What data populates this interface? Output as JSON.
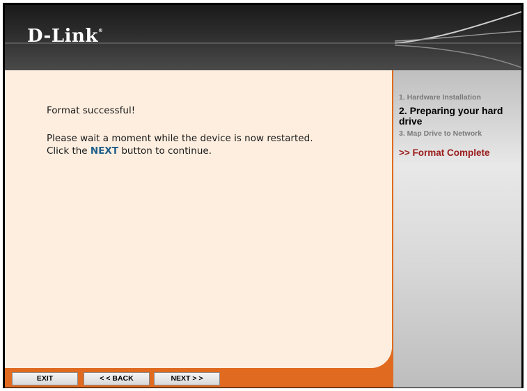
{
  "header": {
    "logo_text": "D-Link",
    "logo_mark": "®"
  },
  "main": {
    "message_success": "Format successful!",
    "message_line1": "Please wait a moment while the device is now restarted.",
    "message_line2_prefix": "Click the ",
    "message_line2_emphasis": "NEXT",
    "message_line2_suffix": " button to continue."
  },
  "sidebar": {
    "step1": "1. Hardware Installation",
    "step2": "2. Preparing your hard drive",
    "step3": "3. Map Drive to Network",
    "current_step": ">> Format Complete"
  },
  "footer": {
    "exit_label": "EXIT",
    "back_label": "< < BACK",
    "next_label": "NEXT > >"
  },
  "colors": {
    "accent": "#e06a1f",
    "highlight": "#1f5f8b",
    "current_step": "#9b1b1b"
  }
}
